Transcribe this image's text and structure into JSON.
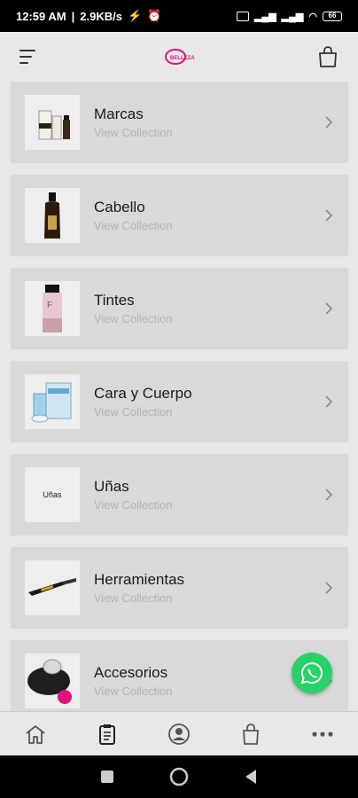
{
  "status_bar": {
    "time": "12:59 AM",
    "speed": "2.9KB/s",
    "battery": "66"
  },
  "header": {
    "logo_text": "BELLEZA"
  },
  "collections": [
    {
      "title": "Marcas",
      "subtitle": "View Collection"
    },
    {
      "title": "Cabello",
      "subtitle": "View Collection"
    },
    {
      "title": "Tintes",
      "subtitle": "View Collection"
    },
    {
      "title": "Cara y Cuerpo",
      "subtitle": "View Collection"
    },
    {
      "title": "Uñas",
      "subtitle": "View Collection",
      "thumb_text": "Uñas"
    },
    {
      "title": "Herramientas",
      "subtitle": "View Collection"
    },
    {
      "title": "Accesorios",
      "subtitle": "View Collection"
    }
  ],
  "colors": {
    "accent": "#e0137a",
    "whatsapp": "#25d366",
    "card_bg": "#d9d9d9"
  },
  "tab_bar": {
    "icons": [
      "home-icon",
      "catalog-icon",
      "account-icon",
      "cart-icon",
      "more-icon"
    ]
  }
}
